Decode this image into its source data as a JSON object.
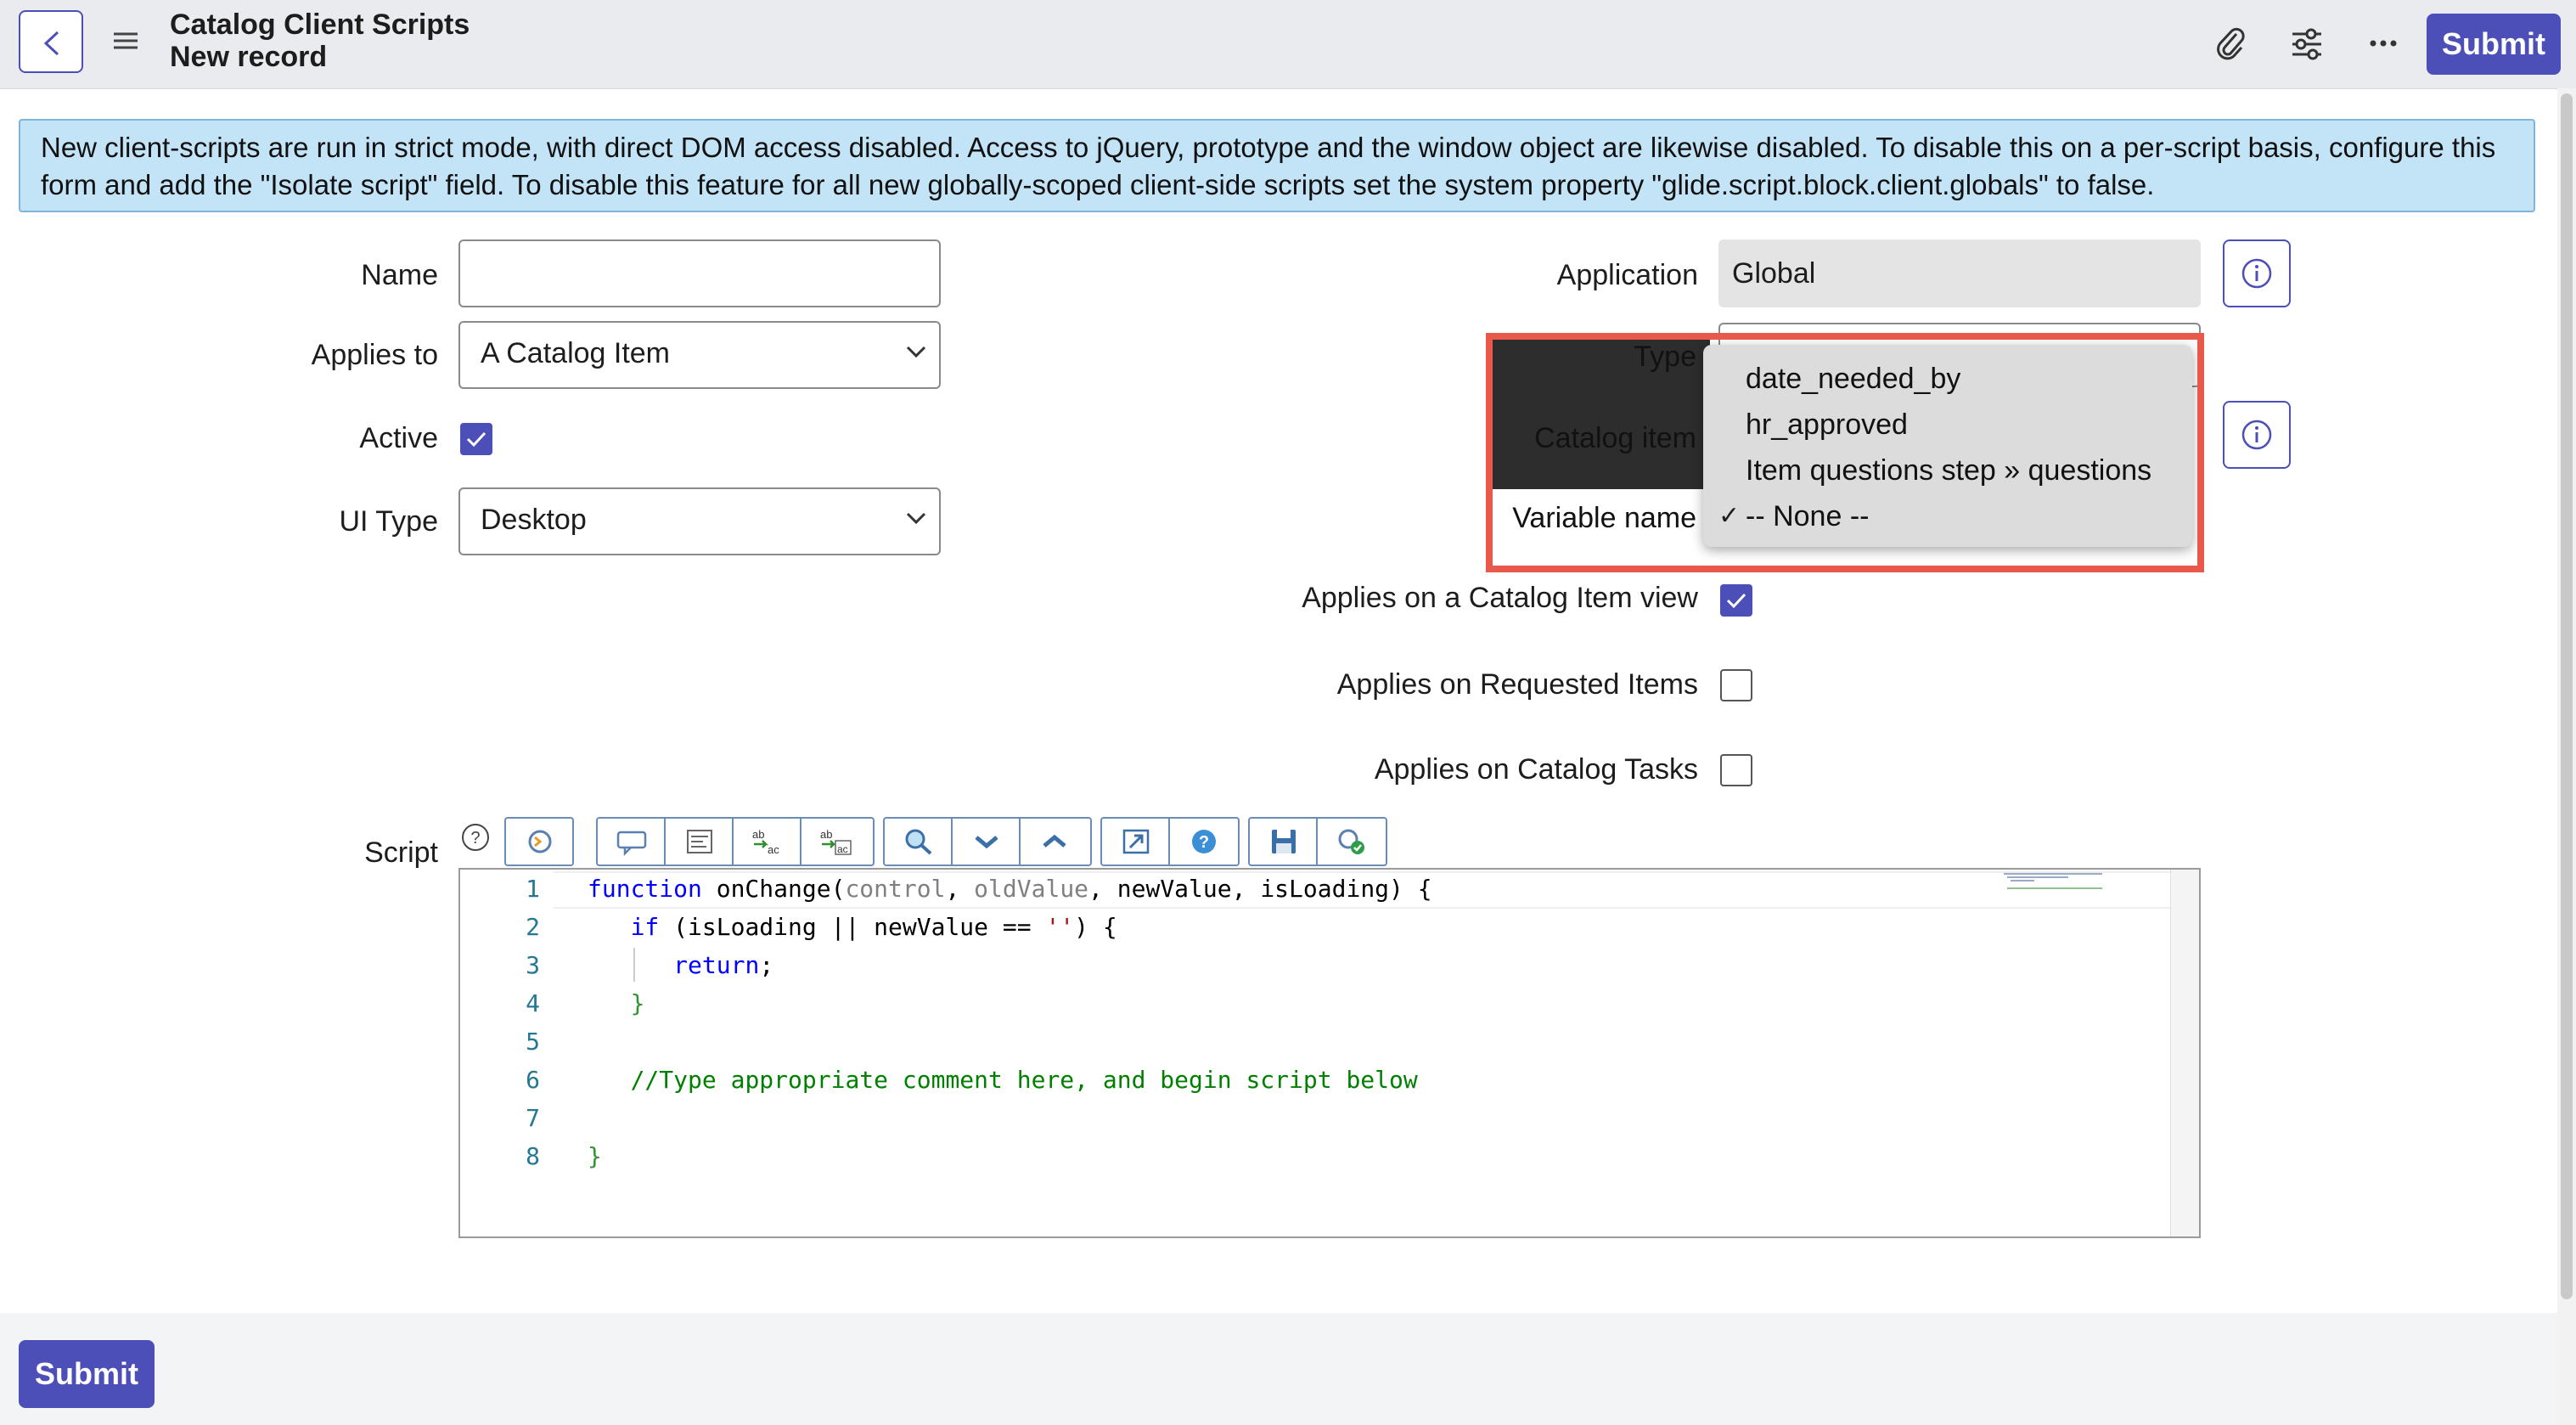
{
  "header": {
    "title": "Catalog Client Scripts",
    "subtitle": "New record",
    "submit_label": "Submit"
  },
  "banner": {
    "text": "New client-scripts are run in strict mode, with direct DOM access disabled. Access to jQuery, prototype and the window object are likewise disabled. To disable this on a per-script basis, configure this form and add the \"Isolate script\" field. To disable this feature for all new globally-scoped client-side scripts set the system property \"glide.script.block.client.globals\" to false."
  },
  "form": {
    "name_label": "Name",
    "name_value": "",
    "applies_to_label": "Applies to",
    "applies_to_value": "A Catalog Item",
    "active_label": "Active",
    "active_checked": true,
    "ui_type_label": "UI Type",
    "ui_type_value": "Desktop",
    "application_label": "Application",
    "application_value": "Global",
    "type_label": "Type",
    "catalog_item_label": "Catalog item",
    "variable_name_label": "Variable name",
    "applies_catalog_view_label": "Applies on a Catalog Item view",
    "applies_catalog_view_checked": true,
    "applies_requested_label": "Applies on Requested Items",
    "applies_requested_checked": false,
    "applies_tasks_label": "Applies on Catalog Tasks",
    "applies_tasks_checked": false,
    "script_label": "Script"
  },
  "variable_dropdown": {
    "options": [
      {
        "label": "date_needed_by",
        "selected": false
      },
      {
        "label": "hr_approved",
        "selected": false
      },
      {
        "label": "Item questions step » questions",
        "selected": false
      },
      {
        "label": "-- None --",
        "selected": true
      }
    ],
    "check_mark": "✓"
  },
  "script_toolbar": {
    "icons": [
      "toggle-syntax-icon",
      "comment-icon",
      "format-code-icon",
      "replace-icon",
      "replace-all-icon",
      "search-icon",
      "find-next-icon",
      "find-previous-icon",
      "fullscreen-icon",
      "help-icon",
      "save-icon",
      "script-debugger-icon"
    ]
  },
  "editor": {
    "line_numbers": [
      "1",
      "2",
      "3",
      "4",
      "5",
      "6",
      "7",
      "8"
    ],
    "lines": [
      "function onChange(control, oldValue, newValue, isLoading) {",
      "   if (isLoading || newValue == '') {",
      "      return;",
      "   }",
      "",
      "   //Type appropriate comment here, and begin script below",
      "",
      "}"
    ]
  },
  "footer": {
    "submit_label": "Submit"
  },
  "colors": {
    "accent": "#4c4fb8",
    "banner_bg": "#c3e3f7",
    "highlight": "#e8584b"
  }
}
